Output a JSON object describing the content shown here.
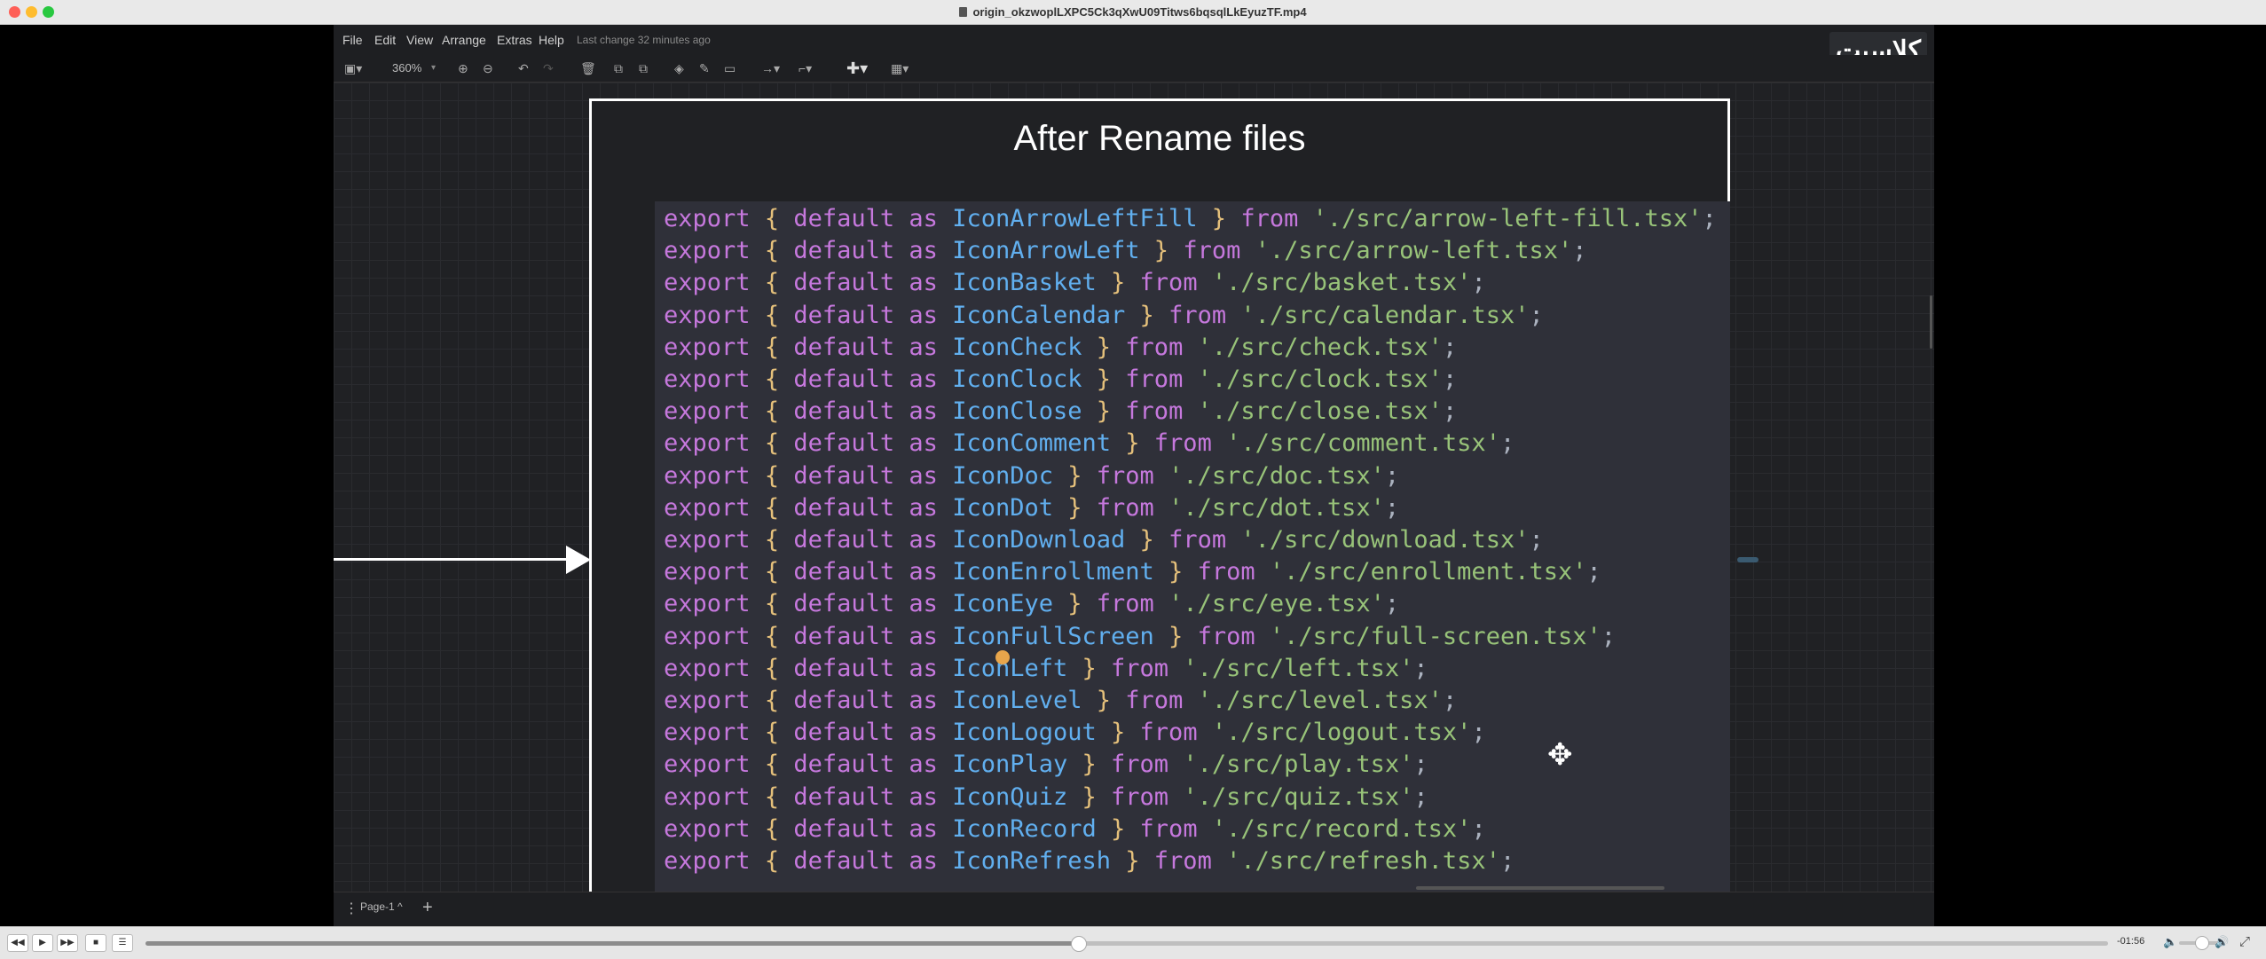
{
  "window": {
    "title": "origin_okzwoplLXPC5Ck3qXwU09Titws6bqsqlLkEyuzTF.mp4"
  },
  "menubar": {
    "items": [
      "File",
      "Edit",
      "View",
      "Arrange",
      "Extras",
      "Help"
    ],
    "last_change": "Last change 32 minutes ago",
    "logo_text": "کلاسبت"
  },
  "toolbar": {
    "zoom": "360%"
  },
  "diagram": {
    "title": "After Rename files",
    "code_lines": [
      {
        "name": "IconArrowLeftFill",
        "path": "'./src/arrow-left-fill.tsx'"
      },
      {
        "name": "IconArrowLeft",
        "path": "'./src/arrow-left.tsx'"
      },
      {
        "name": "IconBasket",
        "path": "'./src/basket.tsx'"
      },
      {
        "name": "IconCalendar",
        "path": "'./src/calendar.tsx'"
      },
      {
        "name": "IconCheck",
        "path": "'./src/check.tsx'"
      },
      {
        "name": "IconClock",
        "path": "'./src/clock.tsx'"
      },
      {
        "name": "IconClose",
        "path": "'./src/close.tsx'"
      },
      {
        "name": "IconComment",
        "path": "'./src/comment.tsx'"
      },
      {
        "name": "IconDoc",
        "path": "'./src/doc.tsx'"
      },
      {
        "name": "IconDot",
        "path": "'./src/dot.tsx'"
      },
      {
        "name": "IconDownload",
        "path": "'./src/download.tsx'"
      },
      {
        "name": "IconEnrollment",
        "path": "'./src/enrollment.tsx'"
      },
      {
        "name": "IconEye",
        "path": "'./src/eye.tsx'"
      },
      {
        "name": "IconFullScreen",
        "path": "'./src/full-screen.tsx'"
      },
      {
        "name": "IconLeft",
        "path": "'./src/left.tsx'"
      },
      {
        "name": "IconLevel",
        "path": "'./src/level.tsx'"
      },
      {
        "name": "IconLogout",
        "path": "'./src/logout.tsx'"
      },
      {
        "name": "IconPlay",
        "path": "'./src/play.tsx'"
      },
      {
        "name": "IconQuiz",
        "path": "'./src/quiz.tsx'"
      },
      {
        "name": "IconRecord",
        "path": "'./src/record.tsx'"
      },
      {
        "name": "IconRefresh",
        "path": "'./src/refresh.tsx'"
      }
    ],
    "keywords": {
      "export": "export",
      "default": "default",
      "as": "as",
      "from": "from",
      "open_brace": "{",
      "close_brace": "}",
      "semicolon": ";"
    }
  },
  "pagebar": {
    "page_tab": "Page-1 ^",
    "add_page": "+"
  },
  "player": {
    "time_remaining": "-01:56",
    "progress_fraction": 0.475
  },
  "colors": {
    "keyword": "#c678dd",
    "brace": "#e5c07b",
    "identifier": "#61afef",
    "string": "#98c379"
  }
}
